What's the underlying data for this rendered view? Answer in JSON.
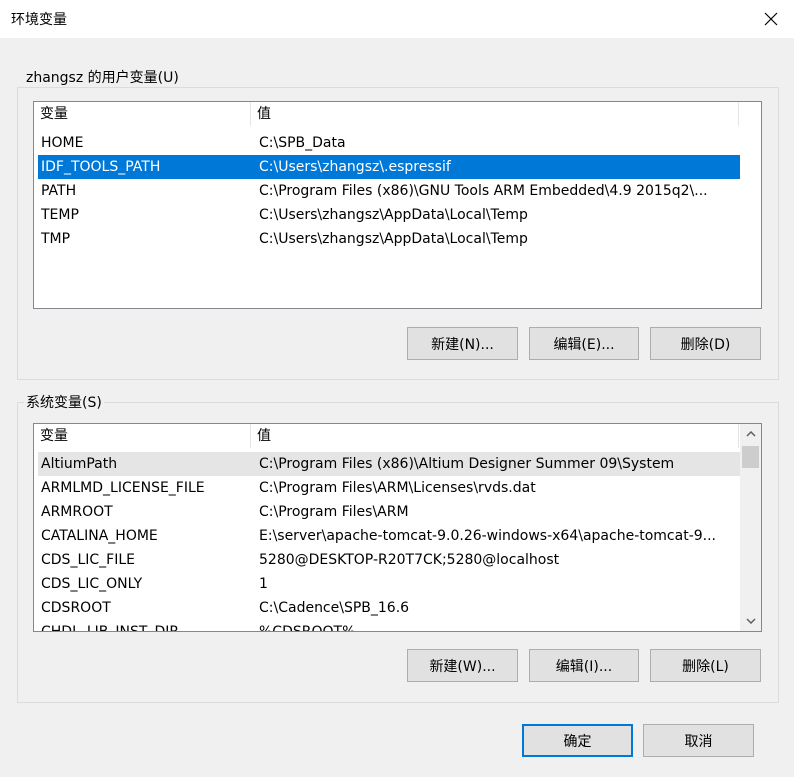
{
  "window": {
    "title": "环境变量",
    "close_icon": "close-icon"
  },
  "user_vars": {
    "label": "zhangsz 的用户变量(U)",
    "headers": [
      "变量",
      "值"
    ],
    "rows": [
      {
        "name": "HOME",
        "value": "C:\\SPB_Data"
      },
      {
        "name": "IDF_TOOLS_PATH",
        "value": "C:\\Users\\zhangsz\\.espressif"
      },
      {
        "name": "PATH",
        "value": "C:\\Program Files (x86)\\GNU Tools ARM Embedded\\4.9 2015q2\\..."
      },
      {
        "name": "TEMP",
        "value": "C:\\Users\\zhangsz\\AppData\\Local\\Temp"
      },
      {
        "name": "TMP",
        "value": "C:\\Users\\zhangsz\\AppData\\Local\\Temp"
      }
    ],
    "selected_index": 1,
    "buttons": {
      "new": "新建(N)...",
      "edit": "编辑(E)...",
      "delete": "删除(D)"
    }
  },
  "system_vars": {
    "label": "系统变量(S)",
    "headers": [
      "变量",
      "值"
    ],
    "rows": [
      {
        "name": "AltiumPath",
        "value": "C:\\Program Files (x86)\\Altium Designer Summer 09\\System"
      },
      {
        "name": "ARMLMD_LICENSE_FILE",
        "value": "C:\\Program Files\\ARM\\Licenses\\rvds.dat"
      },
      {
        "name": "ARMROOT",
        "value": "C:\\Program Files\\ARM"
      },
      {
        "name": "CATALINA_HOME",
        "value": "E:\\server\\apache-tomcat-9.0.26-windows-x64\\apache-tomcat-9..."
      },
      {
        "name": "CDS_LIC_FILE",
        "value": "5280@DESKTOP-R20T7CK;5280@localhost"
      },
      {
        "name": "CDS_LIC_ONLY",
        "value": "1"
      },
      {
        "name": "CDSROOT",
        "value": "C:\\Cadence\\SPB_16.6"
      },
      {
        "name": "CHDL_LIB_INST_DIR",
        "value": "%CDSROOT%"
      }
    ],
    "highlighted_index": 0,
    "buttons": {
      "new": "新建(W)...",
      "edit": "编辑(I)...",
      "delete": "删除(L)"
    }
  },
  "footer": {
    "ok": "确定",
    "cancel": "取消"
  }
}
